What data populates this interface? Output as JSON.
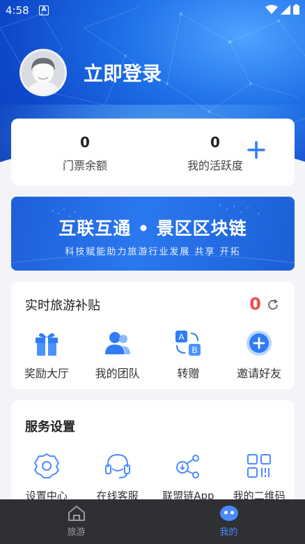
{
  "status_bar": {
    "time": "4:58",
    "notification_glyph": "A"
  },
  "profile": {
    "login_label": "立即登录"
  },
  "stats": [
    {
      "value": "0",
      "label": "门票余额"
    },
    {
      "value": "0",
      "label": "我的活跃度"
    }
  ],
  "banner": {
    "title": "互联互通 • 景区区块链",
    "subtitle": "科技赋能助力旅游行业发展 共享 开拓"
  },
  "subsidy": {
    "title": "实时旅游补贴",
    "count": "0",
    "items": [
      {
        "label": "奖励大厅",
        "icon": "gift-icon"
      },
      {
        "label": "我的团队",
        "icon": "team-icon"
      },
      {
        "label": "转赠",
        "icon": "transfer-icon"
      },
      {
        "label": "邀请好友",
        "icon": "invite-icon"
      }
    ]
  },
  "services": {
    "title": "服务设置",
    "items": [
      {
        "label": "设置中心",
        "icon": "settings-icon"
      },
      {
        "label": "在线客服",
        "icon": "headset-icon"
      },
      {
        "label": "联盟链App",
        "icon": "share-nodes-icon"
      },
      {
        "label": "我的二维码",
        "icon": "qrcode-icon"
      }
    ]
  },
  "tabbar": {
    "tabs": [
      {
        "label": "旅游",
        "icon": "home-icon",
        "active": false
      },
      {
        "label": "我的",
        "icon": "profile-face-icon",
        "active": true
      }
    ]
  },
  "colors": {
    "accent": "#2f7cf6",
    "counter": "#f24b4b",
    "tab_active": "#4a8bff",
    "tab_inactive": "#9a9ba0",
    "hero": "#1f6fe8"
  }
}
